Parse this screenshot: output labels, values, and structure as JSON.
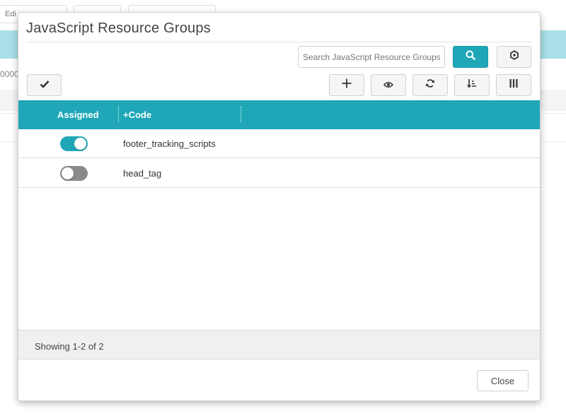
{
  "background": {
    "edit_label": "Edi",
    "partial_text": "0000"
  },
  "modal": {
    "title": "JavaScript Resource Groups",
    "search": {
      "placeholder": "Search JavaScript Resource Groups",
      "value": ""
    },
    "toolbar": {
      "search_icon": "search-icon",
      "settings_icon": "gear-icon",
      "select_icon": "check-icon",
      "add_icon": "plus-icon",
      "view_icon": "eye-icon",
      "refresh_icon": "refresh-icon",
      "sort_icon": "sort-icon",
      "columns_icon": "columns-icon"
    },
    "grid": {
      "columns": {
        "assigned": "Assigned",
        "code": "+Code"
      },
      "rows": [
        {
          "assigned": true,
          "code": "footer_tracking_scripts"
        },
        {
          "assigned": false,
          "code": "head_tag"
        }
      ],
      "footer": "Showing 1-2 of 2"
    },
    "close_label": "Close"
  },
  "colors": {
    "accent": "#1fa7b8",
    "toggle_on": "#1fa7b8",
    "toggle_off": "#8a8a8a"
  }
}
